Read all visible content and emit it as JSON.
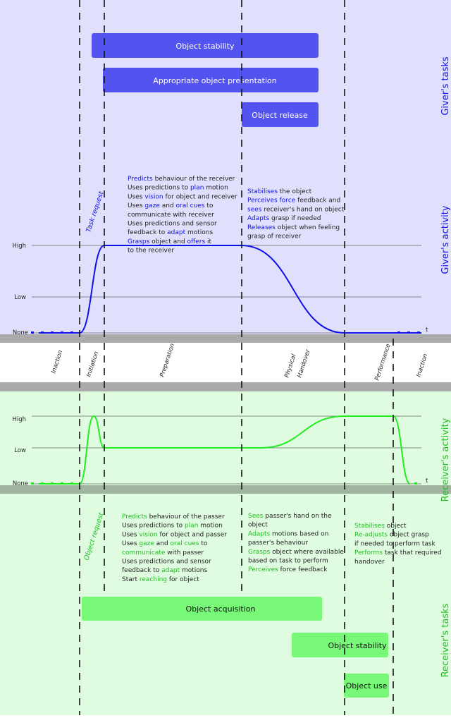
{
  "colors": {
    "giver": "#1010e8",
    "giver_box": "#5353f0",
    "giver_bg": "#e0e0fc",
    "receiver": "#20c020",
    "receiver_curve": "#22ee22",
    "receiver_box": "#77f977",
    "receiver_bg": "#e0fce0",
    "bar": "#aaaaaa",
    "receiver_bar": "#9fb59f"
  },
  "side_labels": {
    "giver_tasks": "Giver's tasks",
    "giver_activity": "Giver's activity",
    "receiver_activity": "Receiver's activity",
    "receiver_tasks": "Receiver's tasks"
  },
  "giver_tasks": [
    "Object stability",
    "Appropriate object presentation",
    "Object release"
  ],
  "receiver_tasks": [
    "Object acquisition",
    "Object stability",
    "Object use"
  ],
  "levels": {
    "high": "High",
    "low": "Low",
    "none": "None",
    "t": "t"
  },
  "events": {
    "task_request": "Task request",
    "object_request": "Object request"
  },
  "phases": [
    "Inaction",
    "Initiation",
    "Preparation",
    "Physical",
    "Handover",
    "Performance",
    "Inaction"
  ],
  "giver_curve": [
    "None",
    "None",
    "High",
    "High",
    "None",
    "None"
  ],
  "receiver_curve": [
    "None",
    "None",
    "High",
    "Low",
    "Low",
    "High",
    "High",
    "None"
  ],
  "giver_activity": {
    "preparation": [
      [
        [
          "Predicts",
          1
        ],
        [
          " behaviour of the receiver",
          0
        ]
      ],
      [
        [
          "Uses predictions to ",
          0
        ],
        [
          "plan",
          1
        ],
        [
          " motion",
          0
        ]
      ],
      [
        [
          "Uses ",
          0
        ],
        [
          "vision",
          1
        ],
        [
          " for object and receiver",
          0
        ]
      ],
      [
        [
          "Uses ",
          0
        ],
        [
          "gaze",
          1
        ],
        [
          " and ",
          0
        ],
        [
          "oral cues",
          1
        ],
        [
          " to",
          0
        ]
      ],
      [
        [
          "communicate with receiver",
          0
        ]
      ],
      [
        [
          "Uses predictions and sensor",
          0
        ]
      ],
      [
        [
          "feedback to ",
          0
        ],
        [
          "adapt",
          1
        ],
        [
          " motions",
          0
        ]
      ],
      [
        [
          "Grasps",
          1
        ],
        [
          " object and ",
          0
        ],
        [
          "offers",
          1
        ],
        [
          " it",
          0
        ]
      ],
      [
        [
          "to the receiver",
          0
        ]
      ]
    ],
    "handover": [
      [
        [
          "Stabilises",
          1
        ],
        [
          " the object",
          0
        ]
      ],
      [
        [
          "Perceives force",
          1
        ],
        [
          " feedback and",
          0
        ]
      ],
      [
        [
          "sees",
          1
        ],
        [
          " receiver's hand on object",
          0
        ]
      ],
      [
        [
          "Adapts",
          1
        ],
        [
          " grasp if needed",
          0
        ]
      ],
      [
        [
          "Releases",
          1
        ],
        [
          " object when feeling",
          0
        ]
      ],
      [
        [
          "grasp of receiver",
          0
        ]
      ]
    ]
  },
  "receiver_activity": {
    "preparation": [
      [
        [
          "Predicts",
          1
        ],
        [
          " behaviour of the passer",
          0
        ]
      ],
      [
        [
          "Uses predictions to ",
          0
        ],
        [
          "plan",
          1
        ],
        [
          " motion",
          0
        ]
      ],
      [
        [
          "Uses ",
          0
        ],
        [
          "vision",
          1
        ],
        [
          " for object and passer",
          0
        ]
      ],
      [
        [
          "Uses ",
          0
        ],
        [
          "gaze",
          1
        ],
        [
          " and ",
          0
        ],
        [
          "oral cues",
          1
        ],
        [
          " to",
          0
        ]
      ],
      [
        [
          "communicate",
          1
        ],
        [
          " with passer",
          0
        ]
      ],
      [
        [
          "Uses predictions and sensor",
          0
        ]
      ],
      [
        [
          "feedback to ",
          0
        ],
        [
          "adapt",
          1
        ],
        [
          " motions",
          0
        ]
      ],
      [
        [
          "Start ",
          0
        ],
        [
          "reaching",
          1
        ],
        [
          " for object",
          0
        ]
      ]
    ],
    "handover": [
      [
        [
          "Sees",
          1
        ],
        [
          " passer's hand on the",
          0
        ]
      ],
      [
        [
          "object",
          0
        ]
      ],
      [
        [
          "Adapts",
          1
        ],
        [
          " motions based on",
          0
        ]
      ],
      [
        [
          "passer's behaviour",
          0
        ]
      ],
      [
        [
          "Grasps",
          1
        ],
        [
          " object where available",
          0
        ]
      ],
      [
        [
          "based on task to perform",
          0
        ]
      ],
      [
        [
          "Perceives",
          1
        ],
        [
          " force feedback",
          0
        ]
      ]
    ],
    "performance": [
      [
        [
          "Stabilises",
          1
        ],
        [
          " object",
          0
        ]
      ],
      [
        [
          "Re-adjusts",
          1
        ],
        [
          " object grasp",
          0
        ]
      ],
      [
        [
          "if needed to perform task",
          0
        ]
      ],
      [
        [
          "Performs",
          1
        ],
        [
          " task that required",
          0
        ]
      ],
      [
        [
          "handover",
          0
        ]
      ]
    ]
  }
}
